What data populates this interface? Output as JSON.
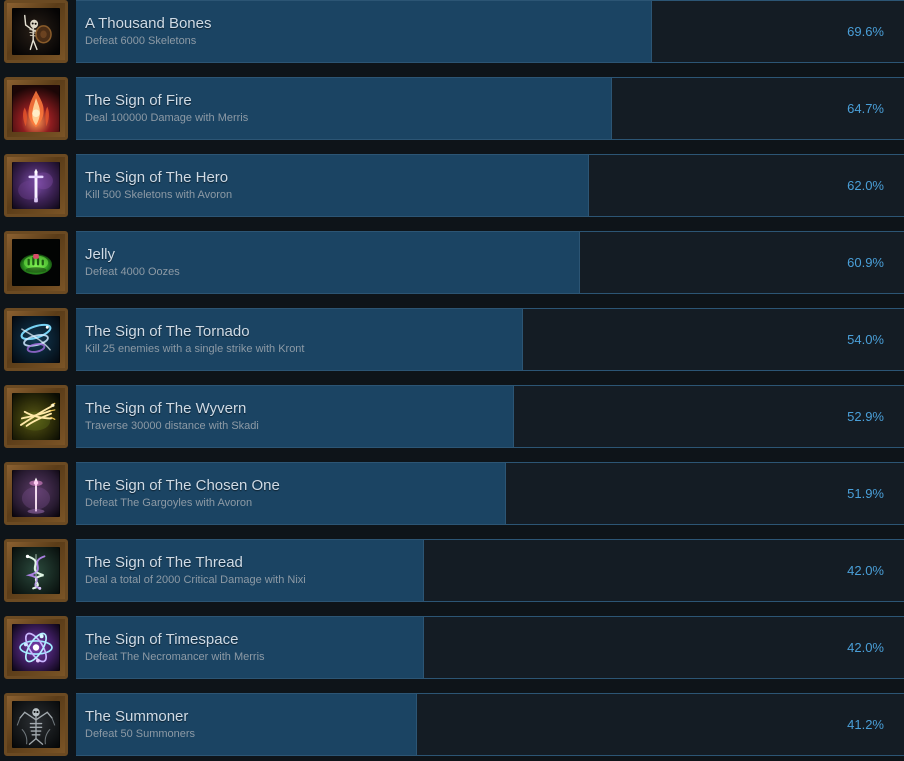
{
  "colors": {
    "page_background": "#0e1419",
    "bar_track": "#141c24",
    "bar_fill": "#1b4463",
    "bar_border": "#2c5574",
    "title_text": "#cfdbe6",
    "description_text": "#8d9aa5",
    "percent_text": "#4a9fd8",
    "icon_frame": "#6b4a22"
  },
  "achievements": [
    {
      "title": "A Thousand Bones",
      "description": "Defeat 6000 Skeletons",
      "percent_label": "69.6%",
      "percent_value": 69.6,
      "icon_name": "skeleton-warrior-icon"
    },
    {
      "title": "The Sign of Fire",
      "description": "Deal 100000 Damage with Merris",
      "percent_label": "64.7%",
      "percent_value": 64.7,
      "icon_name": "flame-icon"
    },
    {
      "title": "The Sign of The Hero",
      "description": "Kill 500 Skeletons with Avoron",
      "percent_label": "62.0%",
      "percent_value": 62.0,
      "icon_name": "glowing-sword-icon"
    },
    {
      "title": "Jelly",
      "description": "Defeat 4000 Oozes",
      "percent_label": "60.9%",
      "percent_value": 60.9,
      "icon_name": "green-ooze-icon"
    },
    {
      "title": "The Sign of The Tornado",
      "description": "Kill 25 enemies with a single strike with Kront",
      "percent_label": "54.0%",
      "percent_value": 54.0,
      "icon_name": "tornado-swirl-icon"
    },
    {
      "title": "The Sign of The Wyvern",
      "description": "Traverse 30000 distance with Skadi",
      "percent_label": "52.9%",
      "percent_value": 52.9,
      "icon_name": "wyvern-wing-icon"
    },
    {
      "title": "The Sign of The Chosen One",
      "description": "Defeat The Gargoyles with Avoron",
      "percent_label": "51.9%",
      "percent_value": 51.9,
      "icon_name": "light-beam-icon"
    },
    {
      "title": "The Sign of The Thread",
      "description": "Deal a total of 2000 Critical Damage with Nixi",
      "percent_label": "42.0%",
      "percent_value": 42.0,
      "icon_name": "twisted-thread-icon"
    },
    {
      "title": "The Sign of Timespace",
      "description": "Defeat The Necromancer with Merris",
      "percent_label": "42.0%",
      "percent_value": 42.0,
      "icon_name": "orbiting-planet-icon"
    },
    {
      "title": "The Summoner",
      "description": "Defeat 50 Summoners",
      "percent_label": "41.2%",
      "percent_value": 41.2,
      "icon_name": "skeletal-summoner-icon"
    }
  ]
}
